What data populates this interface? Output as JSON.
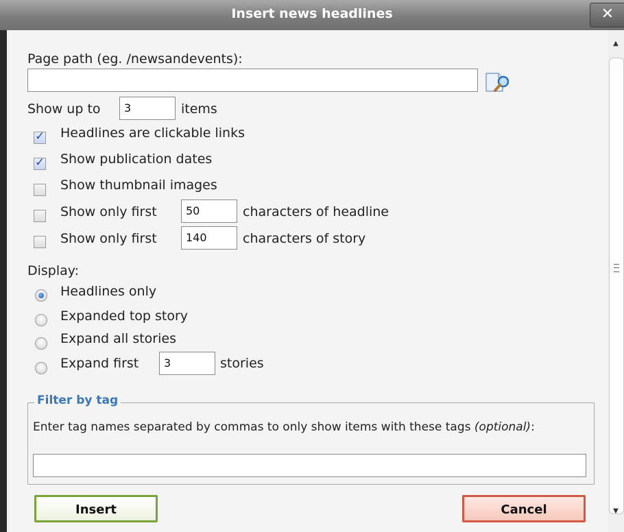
{
  "dialog": {
    "title": "Insert news headlines",
    "close_label": "✕"
  },
  "page_path": {
    "label": "Page path (eg. /newsandevents):",
    "value": "",
    "browse_icon": "search-page-icon"
  },
  "show_up_to": {
    "prefix": "Show up to",
    "value": "3",
    "suffix": "items"
  },
  "options": {
    "clickable_links": {
      "label": "Headlines are clickable links",
      "checked": true
    },
    "publication_dates": {
      "label": "Show publication dates",
      "checked": true
    },
    "thumbnail_images": {
      "label": "Show thumbnail images",
      "checked": false
    },
    "headline_chars": {
      "prefix": "Show only first",
      "value": "50",
      "suffix": "characters of headline",
      "checked": false
    },
    "story_chars": {
      "prefix": "Show only first",
      "value": "140",
      "suffix": "characters of story",
      "checked": false
    }
  },
  "display": {
    "label": "Display:",
    "headlines_only": {
      "label": "Headlines only",
      "selected": true
    },
    "expanded_top": {
      "label": "Expanded top story",
      "selected": false
    },
    "expand_all": {
      "label": "Expand all stories",
      "selected": false
    },
    "expand_first": {
      "prefix": "Expand first",
      "value": "3",
      "suffix": "stories",
      "selected": false
    }
  },
  "filter": {
    "legend": "Filter by tag",
    "description": "Enter tag names separated by commas to only show items with these tags",
    "optional": "(optional)",
    "colon": ":",
    "value": ""
  },
  "buttons": {
    "insert": "Insert",
    "cancel": "Cancel"
  },
  "colors": {
    "legend": "#3a78b8",
    "insert_border": "#7aa23a",
    "cancel_border": "#d25a45"
  }
}
